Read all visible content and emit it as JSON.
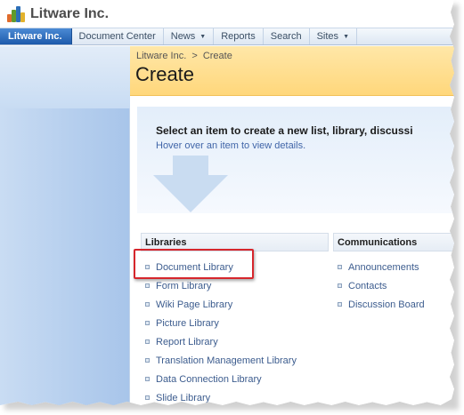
{
  "site": {
    "title": "Litware Inc.",
    "logo_icon": "litware-logo-icon"
  },
  "topnav": {
    "tabs": [
      {
        "label": "Litware Inc.",
        "active": true,
        "dropdown": false
      },
      {
        "label": "Document Center",
        "active": false,
        "dropdown": false
      },
      {
        "label": "News",
        "active": false,
        "dropdown": true
      },
      {
        "label": "Reports",
        "active": false,
        "dropdown": false
      },
      {
        "label": "Search",
        "active": false,
        "dropdown": false
      },
      {
        "label": "Sites",
        "active": false,
        "dropdown": true
      }
    ],
    "dropdown_icon": "chevron-down-icon"
  },
  "breadcrumb": {
    "root": "Litware Inc.",
    "separator": ">",
    "current": "Create"
  },
  "page": {
    "title": "Create"
  },
  "intro": {
    "heading": "Select an item to create a new list, library, discussi",
    "hint": "Hover over an item to view details."
  },
  "groups": {
    "libraries": {
      "header": "Libraries",
      "items": [
        "Document Library",
        "Form Library",
        "Wiki Page Library",
        "Picture Library",
        "Report Library",
        "Translation Management Library",
        "Data Connection Library",
        "Slide Library"
      ]
    },
    "communications": {
      "header": "Communications",
      "items": [
        "Announcements",
        "Contacts",
        "Discussion Board"
      ]
    }
  },
  "colors": {
    "nav_active": "#1d5aab",
    "title_area": "#ffd77b",
    "link": "#3c5c8e",
    "highlight": "#d6262c"
  }
}
